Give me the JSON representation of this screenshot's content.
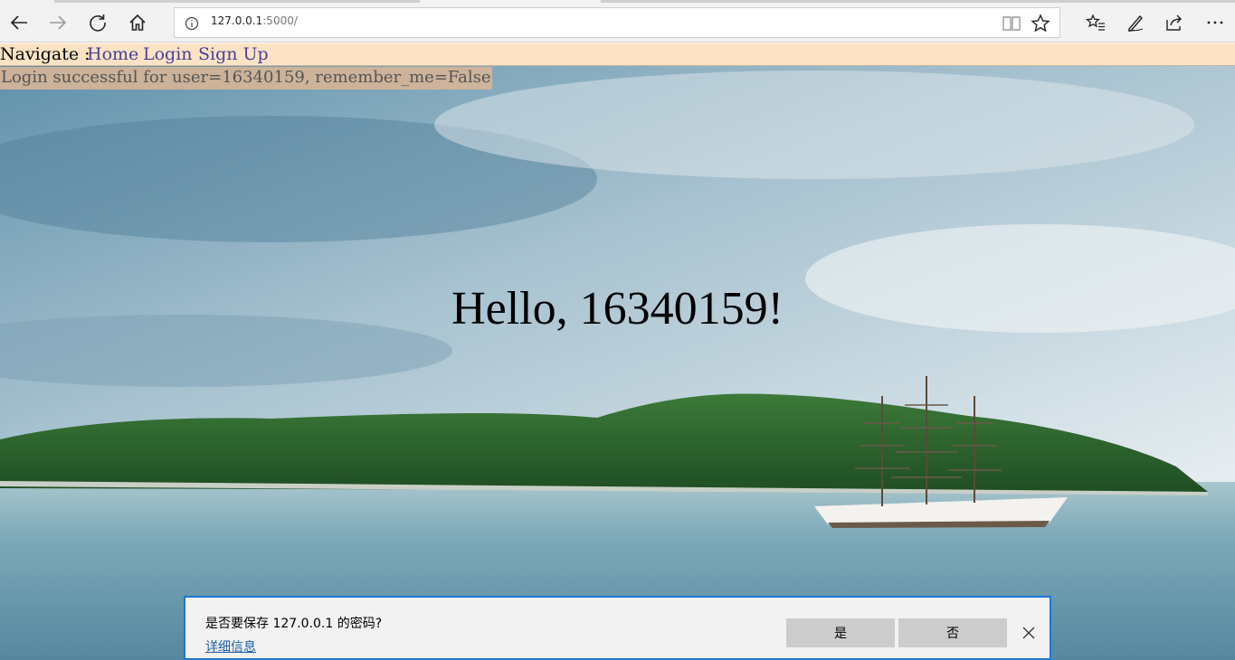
{
  "browser": {
    "url_host": "127.0.0.1",
    "url_port": ":5000/",
    "icons": [
      "back-icon",
      "forward-icon",
      "refresh-icon",
      "home-icon",
      "info-icon",
      "reading-view-icon",
      "favorite-star-icon",
      "favorites-hub-icon",
      "pen-icon",
      "share-icon",
      "more-icon"
    ]
  },
  "navbar": {
    "label": "Navigate :",
    "links": [
      "Home",
      "Login",
      "Sign Up"
    ]
  },
  "flash": {
    "message": "Login successful for user=16340159, remember_me=False"
  },
  "main": {
    "greeting": "Hello, 16340159!"
  },
  "password_bar": {
    "prompt": "是否要保存 127.0.0.1 的密码?",
    "details_link": "详细信息",
    "yes_label": "是",
    "no_label": "否"
  },
  "colors": {
    "navbar_bg": "#fde3c4",
    "link": "#4a3f9a",
    "flash_bg": "#d6b596",
    "accent": "#1b78d6"
  }
}
